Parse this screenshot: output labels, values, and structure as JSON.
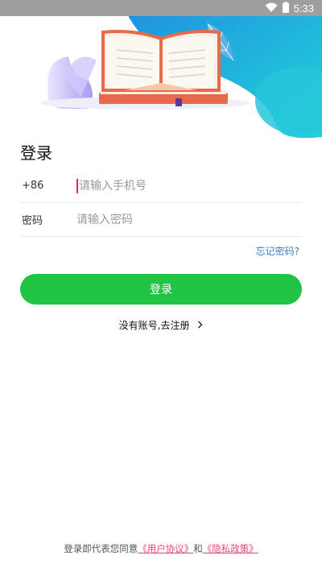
{
  "status_bar": {
    "time": "5:33",
    "wifi_icon": "wifi-icon",
    "battery_icon": "battery-icon"
  },
  "hero": {
    "illustration": "open-book-illustration"
  },
  "page": {
    "title": "登录"
  },
  "phone_row": {
    "prefix": "+86",
    "placeholder": "请输入手机号",
    "value": ""
  },
  "password_row": {
    "label": "密码",
    "placeholder": "请输入密码",
    "value": ""
  },
  "forgot_password": "忘记密码?",
  "login_button": "登录",
  "register_link": {
    "text": "没有账号,去注册",
    "icon": "chevron-right-icon"
  },
  "agreement": {
    "prefix": "登录即代表您同意",
    "user_agreement": "《用户协议》",
    "and": "和",
    "privacy_policy": "《隐私政策》"
  },
  "colors": {
    "primary_green": "#21c345",
    "link_blue": "#3b82c4",
    "link_pink": "#e4477d",
    "hero_blue": "#2bb3e0"
  }
}
